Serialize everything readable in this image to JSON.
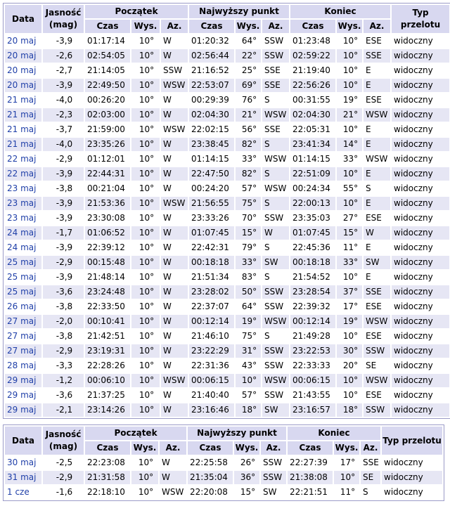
{
  "headers": {
    "date": "Data",
    "brightness": "Jasność",
    "brightness_unit": "(mag)",
    "start": "Początek",
    "highest": "Najwyższy punkt",
    "end": "Koniec",
    "pass_type": "Typ przelotu",
    "time": "Czas",
    "alt": "Wys.",
    "az": "Az."
  },
  "rows": [
    {
      "date": "20 maj",
      "mag": "-3,9",
      "s_time": "01:17:14",
      "s_alt": "10°",
      "s_az": "W",
      "h_time": "01:20:32",
      "h_alt": "64°",
      "h_az": "SSW",
      "e_time": "01:23:48",
      "e_alt": "10°",
      "e_az": "ESE",
      "type": "widoczny"
    },
    {
      "date": "20 maj",
      "mag": "-2,6",
      "s_time": "02:54:05",
      "s_alt": "10°",
      "s_az": "W",
      "h_time": "02:56:44",
      "h_alt": "22°",
      "h_az": "SSW",
      "e_time": "02:59:22",
      "e_alt": "10°",
      "e_az": "SSE",
      "type": "widoczny"
    },
    {
      "date": "20 maj",
      "mag": "-2,7",
      "s_time": "21:14:05",
      "s_alt": "10°",
      "s_az": "SSW",
      "h_time": "21:16:52",
      "h_alt": "25°",
      "h_az": "SSE",
      "e_time": "21:19:40",
      "e_alt": "10°",
      "e_az": "E",
      "type": "widoczny"
    },
    {
      "date": "20 maj",
      "mag": "-3,9",
      "s_time": "22:49:50",
      "s_alt": "10°",
      "s_az": "WSW",
      "h_time": "22:53:07",
      "h_alt": "69°",
      "h_az": "SSE",
      "e_time": "22:56:26",
      "e_alt": "10°",
      "e_az": "E",
      "type": "widoczny"
    },
    {
      "date": "21 maj",
      "mag": "-4,0",
      "s_time": "00:26:20",
      "s_alt": "10°",
      "s_az": "W",
      "h_time": "00:29:39",
      "h_alt": "76°",
      "h_az": "S",
      "e_time": "00:31:55",
      "e_alt": "19°",
      "e_az": "ESE",
      "type": "widoczny"
    },
    {
      "date": "21 maj",
      "mag": "-2,3",
      "s_time": "02:03:00",
      "s_alt": "10°",
      "s_az": "W",
      "h_time": "02:04:30",
      "h_alt": "21°",
      "h_az": "WSW",
      "e_time": "02:04:30",
      "e_alt": "21°",
      "e_az": "WSW",
      "type": "widoczny"
    },
    {
      "date": "21 maj",
      "mag": "-3,7",
      "s_time": "21:59:00",
      "s_alt": "10°",
      "s_az": "WSW",
      "h_time": "22:02:15",
      "h_alt": "56°",
      "h_az": "SSE",
      "e_time": "22:05:31",
      "e_alt": "10°",
      "e_az": "E",
      "type": "widoczny"
    },
    {
      "date": "21 maj",
      "mag": "-4,0",
      "s_time": "23:35:26",
      "s_alt": "10°",
      "s_az": "W",
      "h_time": "23:38:45",
      "h_alt": "82°",
      "h_az": "S",
      "e_time": "23:41:34",
      "e_alt": "14°",
      "e_az": "E",
      "type": "widoczny"
    },
    {
      "date": "22 maj",
      "mag": "-2,9",
      "s_time": "01:12:01",
      "s_alt": "10°",
      "s_az": "W",
      "h_time": "01:14:15",
      "h_alt": "33°",
      "h_az": "WSW",
      "e_time": "01:14:15",
      "e_alt": "33°",
      "e_az": "WSW",
      "type": "widoczny"
    },
    {
      "date": "22 maj",
      "mag": "-3,9",
      "s_time": "22:44:31",
      "s_alt": "10°",
      "s_az": "W",
      "h_time": "22:47:50",
      "h_alt": "82°",
      "h_az": "S",
      "e_time": "22:51:09",
      "e_alt": "10°",
      "e_az": "E",
      "type": "widoczny"
    },
    {
      "date": "23 maj",
      "mag": "-3,8",
      "s_time": "00:21:04",
      "s_alt": "10°",
      "s_az": "W",
      "h_time": "00:24:20",
      "h_alt": "57°",
      "h_az": "WSW",
      "e_time": "00:24:34",
      "e_alt": "55°",
      "e_az": "S",
      "type": "widoczny"
    },
    {
      "date": "23 maj",
      "mag": "-3,9",
      "s_time": "21:53:36",
      "s_alt": "10°",
      "s_az": "WSW",
      "h_time": "21:56:55",
      "h_alt": "75°",
      "h_az": "S",
      "e_time": "22:00:13",
      "e_alt": "10°",
      "e_az": "E",
      "type": "widoczny"
    },
    {
      "date": "23 maj",
      "mag": "-3,9",
      "s_time": "23:30:08",
      "s_alt": "10°",
      "s_az": "W",
      "h_time": "23:33:26",
      "h_alt": "70°",
      "h_az": "SSW",
      "e_time": "23:35:03",
      "e_alt": "27°",
      "e_az": "ESE",
      "type": "widoczny"
    },
    {
      "date": "24 maj",
      "mag": "-1,7",
      "s_time": "01:06:52",
      "s_alt": "10°",
      "s_az": "W",
      "h_time": "01:07:45",
      "h_alt": "15°",
      "h_az": "W",
      "e_time": "01:07:45",
      "e_alt": "15°",
      "e_az": "W",
      "type": "widoczny"
    },
    {
      "date": "24 maj",
      "mag": "-3,9",
      "s_time": "22:39:12",
      "s_alt": "10°",
      "s_az": "W",
      "h_time": "22:42:31",
      "h_alt": "79°",
      "h_az": "S",
      "e_time": "22:45:36",
      "e_alt": "11°",
      "e_az": "E",
      "type": "widoczny"
    },
    {
      "date": "25 maj",
      "mag": "-2,9",
      "s_time": "00:15:48",
      "s_alt": "10°",
      "s_az": "W",
      "h_time": "00:18:18",
      "h_alt": "33°",
      "h_az": "SW",
      "e_time": "00:18:18",
      "e_alt": "33°",
      "e_az": "SW",
      "type": "widoczny"
    },
    {
      "date": "25 maj",
      "mag": "-3,9",
      "s_time": "21:48:14",
      "s_alt": "10°",
      "s_az": "W",
      "h_time": "21:51:34",
      "h_alt": "83°",
      "h_az": "S",
      "e_time": "21:54:52",
      "e_alt": "10°",
      "e_az": "E",
      "type": "widoczny"
    },
    {
      "date": "25 maj",
      "mag": "-3,6",
      "s_time": "23:24:48",
      "s_alt": "10°",
      "s_az": "W",
      "h_time": "23:28:02",
      "h_alt": "50°",
      "h_az": "SSW",
      "e_time": "23:28:54",
      "e_alt": "37°",
      "e_az": "SSE",
      "type": "widoczny"
    },
    {
      "date": "26 maj",
      "mag": "-3,8",
      "s_time": "22:33:50",
      "s_alt": "10°",
      "s_az": "W",
      "h_time": "22:37:07",
      "h_alt": "64°",
      "h_az": "SSW",
      "e_time": "22:39:32",
      "e_alt": "17°",
      "e_az": "ESE",
      "type": "widoczny"
    },
    {
      "date": "27 maj",
      "mag": "-2,0",
      "s_time": "00:10:41",
      "s_alt": "10°",
      "s_az": "W",
      "h_time": "00:12:14",
      "h_alt": "19°",
      "h_az": "WSW",
      "e_time": "00:12:14",
      "e_alt": "19°",
      "e_az": "WSW",
      "type": "widoczny"
    },
    {
      "date": "27 maj",
      "mag": "-3,8",
      "s_time": "21:42:51",
      "s_alt": "10°",
      "s_az": "W",
      "h_time": "21:46:10",
      "h_alt": "75°",
      "h_az": "S",
      "e_time": "21:49:28",
      "e_alt": "10°",
      "e_az": "ESE",
      "type": "widoczny"
    },
    {
      "date": "27 maj",
      "mag": "-2,9",
      "s_time": "23:19:31",
      "s_alt": "10°",
      "s_az": "W",
      "h_time": "23:22:29",
      "h_alt": "31°",
      "h_az": "SSW",
      "e_time": "23:22:53",
      "e_alt": "30°",
      "e_az": "SSW",
      "type": "widoczny"
    },
    {
      "date": "28 maj",
      "mag": "-3,3",
      "s_time": "22:28:26",
      "s_alt": "10°",
      "s_az": "W",
      "h_time": "22:31:36",
      "h_alt": "43°",
      "h_az": "SSW",
      "e_time": "22:33:33",
      "e_alt": "20°",
      "e_az": "SE",
      "type": "widoczny"
    },
    {
      "date": "29 maj",
      "mag": "-1,2",
      "s_time": "00:06:10",
      "s_alt": "10°",
      "s_az": "WSW",
      "h_time": "00:06:15",
      "h_alt": "10°",
      "h_az": "WSW",
      "e_time": "00:06:15",
      "e_alt": "10°",
      "e_az": "WSW",
      "type": "widoczny"
    },
    {
      "date": "29 maj",
      "mag": "-3,6",
      "s_time": "21:37:25",
      "s_alt": "10°",
      "s_az": "W",
      "h_time": "21:40:40",
      "h_alt": "57°",
      "h_az": "SSW",
      "e_time": "21:43:55",
      "e_alt": "10°",
      "e_az": "ESE",
      "type": "widoczny"
    },
    {
      "date": "29 maj",
      "mag": "-2,1",
      "s_time": "23:14:26",
      "s_alt": "10°",
      "s_az": "W",
      "h_time": "23:16:46",
      "h_alt": "18°",
      "h_az": "SW",
      "e_time": "23:16:57",
      "e_alt": "18°",
      "e_az": "SSW",
      "type": "widoczny"
    }
  ],
  "rows2": [
    {
      "date": "30 maj",
      "mag": "-2,5",
      "s_time": "22:23:08",
      "s_alt": "10°",
      "s_az": "W",
      "h_time": "22:25:58",
      "h_alt": "26°",
      "h_az": "SSW",
      "e_time": "22:27:39",
      "e_alt": "17°",
      "e_az": "SSE",
      "type": "widoczny"
    },
    {
      "date": "31 maj",
      "mag": "-2,9",
      "s_time": "21:31:58",
      "s_alt": "10°",
      "s_az": "W",
      "h_time": "21:35:04",
      "h_alt": "36°",
      "h_az": "SSW",
      "e_time": "21:38:08",
      "e_alt": "10°",
      "e_az": "SE",
      "type": "widoczny"
    },
    {
      "date": "1 cze",
      "mag": "-1,6",
      "s_time": "22:18:10",
      "s_alt": "10°",
      "s_az": "WSW",
      "h_time": "22:20:08",
      "h_alt": "15°",
      "h_az": "SW",
      "e_time": "22:21:51",
      "e_alt": "11°",
      "e_az": "S",
      "type": "widoczny"
    }
  ]
}
